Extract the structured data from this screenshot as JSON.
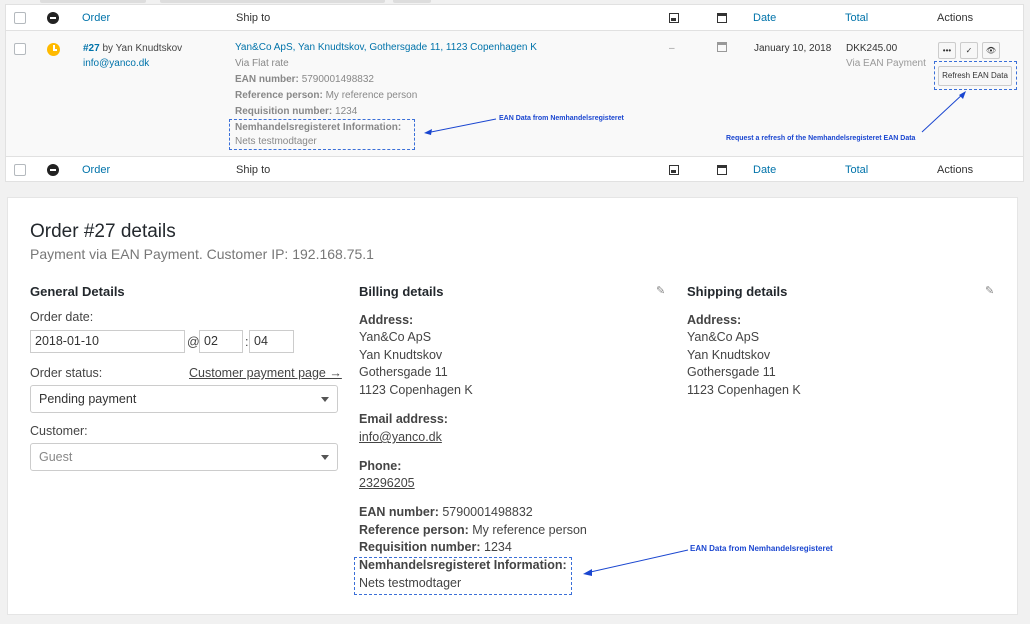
{
  "table": {
    "headers": {
      "order": "Order",
      "ship_to": "Ship to",
      "date": "Date",
      "total": "Total",
      "actions": "Actions"
    },
    "order": {
      "number": "#27",
      "by": "by Yan Knudtskov",
      "email": "info@yanco.dk",
      "ship_address": "Yan&Co ApS, Yan Knudtskov, Gothersgade 11, 1123 Copenhagen K",
      "ship_method": "Via Flat rate",
      "ean_label": "EAN number:",
      "ean_value": "5790001498832",
      "ref_label": "Reference person:",
      "ref_value": "My reference person",
      "req_label": "Requisition number:",
      "req_value": "1234",
      "nem_label": "Nemhandelsregisteret Information:",
      "nem_value": "Nets testmodtager",
      "dash": "–",
      "date": "January 10, 2018",
      "total": "DKK245.00",
      "via": "Via EAN Payment",
      "btn_more": "•••",
      "btn_complete": "✓",
      "btn_view": "👁",
      "refresh": "Refresh EAN Data"
    },
    "annotations": {
      "ean_data": "EAN Data from Nemhandelsregisteret",
      "refresh": "Request a refresh of the Nemhandelsregisteret EAN Data"
    }
  },
  "details": {
    "title": "Order #27 details",
    "subtitle": "Payment via EAN Payment. Customer IP: 192.168.75.1",
    "general": {
      "heading": "General Details",
      "order_date_label": "Order date:",
      "date": "2018-01-10",
      "at": "@",
      "hour": "02",
      "colon": ":",
      "minute": "04",
      "status_label": "Order status:",
      "customer_page_link": "Customer payment page →",
      "status": "Pending payment",
      "customer_label": "Customer:",
      "customer": "Guest"
    },
    "billing": {
      "heading": "Billing details",
      "address_label": "Address:",
      "address": [
        "Yan&Co ApS",
        "Yan Knudtskov",
        "Gothersgade 11",
        "1123 Copenhagen K"
      ],
      "email_label": "Email address:",
      "email": "info@yanco.dk",
      "phone_label": "Phone:",
      "phone": "23296205",
      "ean_label": "EAN number:",
      "ean_value": "5790001498832",
      "ref_label": "Reference person:",
      "ref_value": "My reference person",
      "req_label": "Requisition number:",
      "req_value": "1234",
      "nem_label": "Nemhandelsregisteret Information:",
      "nem_value": "Nets testmodtager"
    },
    "shipping": {
      "heading": "Shipping details",
      "address_label": "Address:",
      "address": [
        "Yan&Co ApS",
        "Yan Knudtskov",
        "Gothersgade 11",
        "1123 Copenhagen K"
      ]
    },
    "annotation": "EAN Data from Nemhandelsregisteret"
  }
}
